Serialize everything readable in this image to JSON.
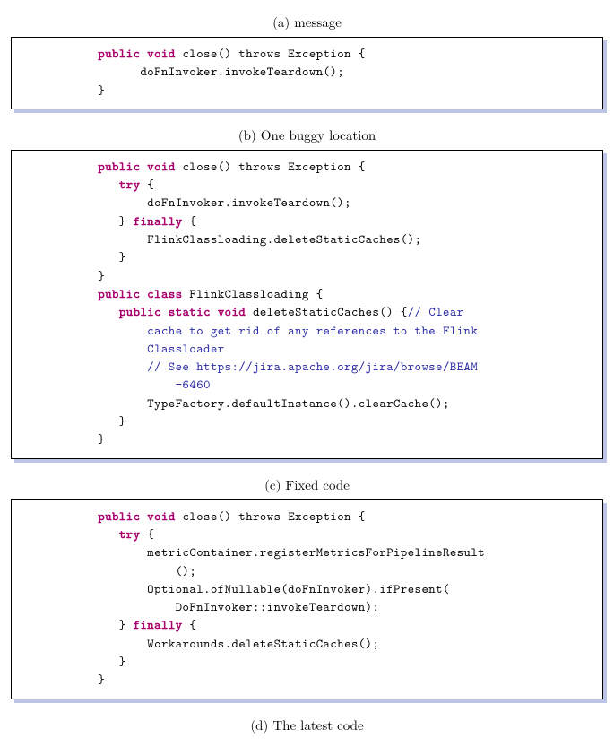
{
  "captions": {
    "a": "(a) message",
    "b": "(b) One buggy location",
    "c": "(c) Fixed code",
    "d": "(d) The latest code"
  },
  "code": {
    "b": {
      "l1a": "public void",
      "l1b": " close() throws Exception {",
      "l2": "      doFnInvoker.invokeTeardown();",
      "l3": "}"
    },
    "c": {
      "l1a": "public void",
      "l1b": " close() throws Exception {",
      "l2a": "   ",
      "l2b": "try",
      "l2c": " {",
      "l3": "       doFnInvoker.invokeTeardown();",
      "l4a": "   } ",
      "l4b": "finally",
      "l4c": " {",
      "l5": "       FlinkClassloading.deleteStaticCaches();",
      "l6": "   }",
      "l7": "}",
      "l8a": "public class",
      "l8b": " FlinkClassloading {",
      "l9a": "   ",
      "l9b": "public static void",
      "l9c": " deleteStaticCaches() {",
      "l9d": "// Clear",
      "l10": "       cache to get rid of any references to the Flink",
      "l11": "       Classloader",
      "l12": "       // See https://jira.apache.org/jira/browse/BEAM",
      "l13": "           −6460",
      "l14": "       TypeFactory.defaultInstance().clearCache();",
      "l15": "   }",
      "l16": "}"
    },
    "d": {
      "l1a": "public void",
      "l1b": " close() throws Exception {",
      "l2a": "   ",
      "l2b": "try",
      "l2c": " {",
      "l3": "       metricContainer.registerMetricsForPipelineResult",
      "l4": "           ();",
      "l5": "       Optional.ofNullable(doFnInvoker).ifPresent(",
      "l6": "           DoFnInvoker::invokeTeardown);",
      "l7a": "   } ",
      "l7b": "finally",
      "l7c": " {",
      "l8": "       Workarounds.deleteStaticCaches();",
      "l9": "   }",
      "l10": "}"
    }
  }
}
